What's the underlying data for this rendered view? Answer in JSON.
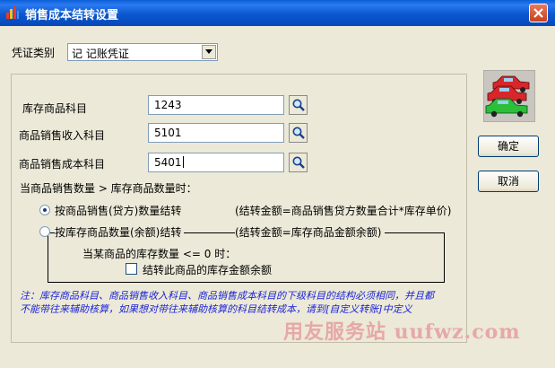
{
  "window": {
    "title": "销售成本结转设置",
    "close_symbol": "✕"
  },
  "voucher": {
    "label": "凭证类别",
    "value": "记 记账凭证"
  },
  "accounts": [
    {
      "label": "库存商品科目",
      "value": "1243"
    },
    {
      "label": "商品销售收入科目",
      "value": "5101"
    },
    {
      "label": "商品销售成本科目",
      "value": "5401"
    }
  ],
  "condition": {
    "heading": "当商品销售数量 > 库存商品数量时："
  },
  "options": {
    "selected": "by_sales",
    "by_sales": {
      "label": "按商品销售(贷方)数量结转",
      "formula": "(结转金额=商品销售贷方数量合计*库存单价)"
    },
    "by_stock": {
      "label": "按库存商品数量(余额)结转",
      "formula": "(结转金额=库存商品金额余额)"
    }
  },
  "sub_condition": {
    "label": "当某商品的库存数量 <= 0 时："
  },
  "checkbox": {
    "label": "结转此商品的库存金额余额",
    "checked": false
  },
  "note": "注：库存商品科目、商品销售收入科目、商品销售成本科目的下级科目的结构必须相同，并且都不能带往来辅助核算，如果想对带往来辅助核算的科目结转成本，请到[自定义转账]中定义",
  "buttons": {
    "ok": "确定",
    "cancel": "取消"
  },
  "watermark": "用友服务站 uufwz.com",
  "colors": {
    "title_bar": "#0a58d0",
    "dialog_bg": "#ece9d8",
    "note_text": "#1d25d6",
    "watermark": "#e6a8a8"
  },
  "icons": [
    "app-icon",
    "close-icon",
    "dropdown-arrow-icon",
    "search-icon",
    "cars-logo-icon"
  ]
}
